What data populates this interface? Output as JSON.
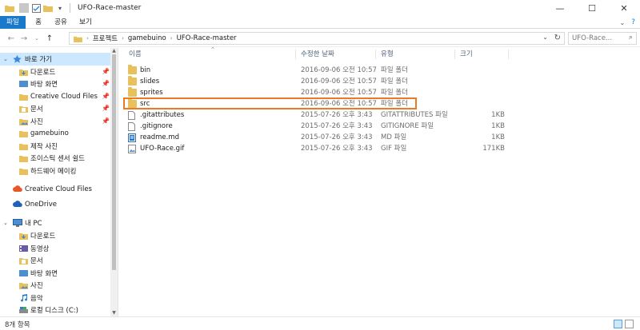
{
  "window": {
    "title": "UFO-Race-master"
  },
  "ribbon": {
    "tabs": [
      "파일",
      "홈",
      "공유",
      "보기"
    ]
  },
  "address": {
    "crumbs": [
      "프로젝트",
      "gamebuino",
      "UFO-Race-master"
    ]
  },
  "search": {
    "placeholder": "UFO-Race..."
  },
  "nav": {
    "quick_access": "바로 가기",
    "items": [
      "다운로드",
      "바탕 화면",
      "Creative Cloud Files",
      "문서",
      "사진",
      "gamebuino",
      "제작 사진",
      "조이스틱 센서 쉴드",
      "하드웨어 메이킹"
    ],
    "creative_cloud": "Creative Cloud Files",
    "onedrive": "OneDrive",
    "this_pc": "내 PC",
    "pc_items": [
      "다운로드",
      "동영상",
      "문서",
      "바탕 화면",
      "사진",
      "음악",
      "로컬 디스크 (C:)"
    ]
  },
  "columns": {
    "name": "이름",
    "modified": "수정한 날짜",
    "type": "유형",
    "size": "크기"
  },
  "files": [
    {
      "name": "bin",
      "modified": "2016-09-06 오전 10:57",
      "type": "파일 폴더",
      "size": "",
      "icon": "folder-icon"
    },
    {
      "name": "slides",
      "modified": "2016-09-06 오전 10:57",
      "type": "파일 폴더",
      "size": "",
      "icon": "folder-icon"
    },
    {
      "name": "sprites",
      "modified": "2016-09-06 오전 10:57",
      "type": "파일 폴더",
      "size": "",
      "icon": "folder-icon"
    },
    {
      "name": "src",
      "modified": "2016-09-06 오전 10:57",
      "type": "파일 폴더",
      "size": "",
      "icon": "folder-icon"
    },
    {
      "name": ".gitattributes",
      "modified": "2015-07-26 오후 3:43",
      "type": "GITATTRIBUTES 파일",
      "size": "1KB",
      "icon": "file-icon"
    },
    {
      "name": ".gitignore",
      "modified": "2015-07-26 오후 3:43",
      "type": "GITIGNORE 파일",
      "size": "1KB",
      "icon": "file-icon"
    },
    {
      "name": "readme.md",
      "modified": "2015-07-26 오후 3:43",
      "type": "MD 파일",
      "size": "1KB",
      "icon": "markdown-file-icon"
    },
    {
      "name": "UFO-Race.gif",
      "modified": "2015-07-26 오후 3:43",
      "type": "GIF 파일",
      "size": "171KB",
      "icon": "image-file-icon"
    }
  ],
  "status": {
    "count": "8개 항목"
  },
  "colors": {
    "accent": "#1979ca",
    "highlight": "#ea7a24",
    "folder": "#e9c15c"
  }
}
